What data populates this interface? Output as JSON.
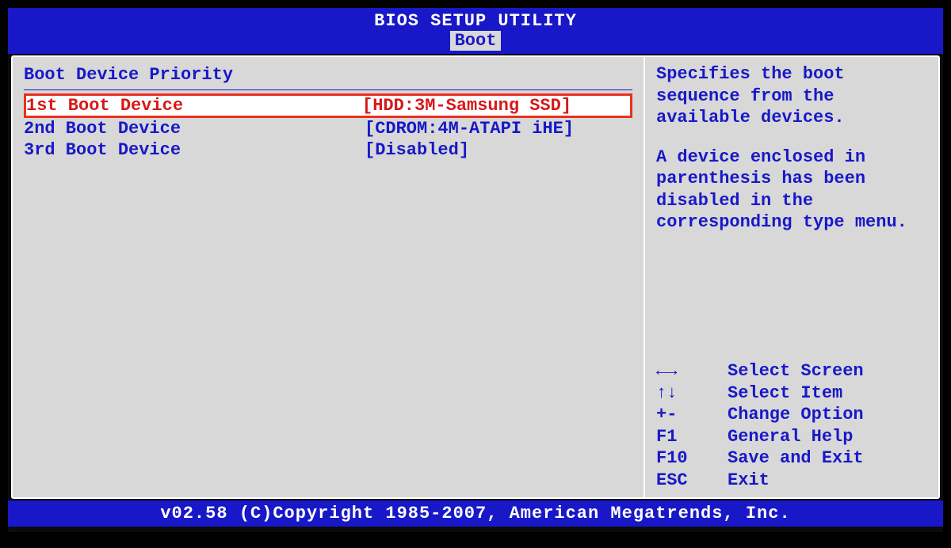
{
  "header": {
    "title": "BIOS SETUP UTILITY",
    "active_tab": "Boot"
  },
  "section": {
    "title": "Boot Device Priority"
  },
  "boot_devices": [
    {
      "label": "1st Boot Device",
      "value": "[HDD:3M-Samsung SSD]",
      "selected": true
    },
    {
      "label": "2nd Boot Device",
      "value": "[CDROM:4M-ATAPI iHE]",
      "selected": false
    },
    {
      "label": "3rd Boot Device",
      "value": "[Disabled]",
      "selected": false
    }
  ],
  "help": {
    "para1": "Specifies the boot sequence from the available devices.",
    "para2": "A device enclosed in parenthesis has been disabled in the corresponding type menu."
  },
  "keys": [
    {
      "symbol": "←→",
      "action": "Select Screen"
    },
    {
      "symbol": "↑↓",
      "action": "Select Item"
    },
    {
      "symbol": "+-",
      "action": "Change Option"
    },
    {
      "symbol": "F1",
      "action": "General Help"
    },
    {
      "symbol": "F10",
      "action": "Save and Exit"
    },
    {
      "symbol": "ESC",
      "action": "Exit"
    }
  ],
  "footer": {
    "text": "v02.58 (C)Copyright 1985-2007, American Megatrends, Inc."
  }
}
